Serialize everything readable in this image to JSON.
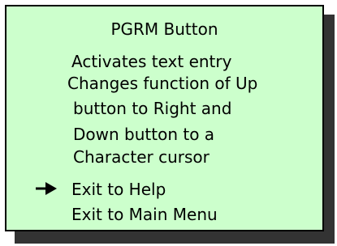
{
  "panel": {
    "title": "PGRM Button",
    "description": [
      "Activates text entry",
      "Changes function of Up",
      "button to Right and",
      "Down button to a",
      "Character cursor"
    ],
    "menu": {
      "selected_indicator": "right-arrow-icon",
      "items": [
        {
          "label": "Exit to Help",
          "selected": true
        },
        {
          "label": "Exit to Main Menu",
          "selected": false
        }
      ]
    }
  },
  "colors": {
    "panel_background": "#ccffcc",
    "panel_border": "#000000",
    "shadow": "#333333",
    "text": "#000000"
  }
}
